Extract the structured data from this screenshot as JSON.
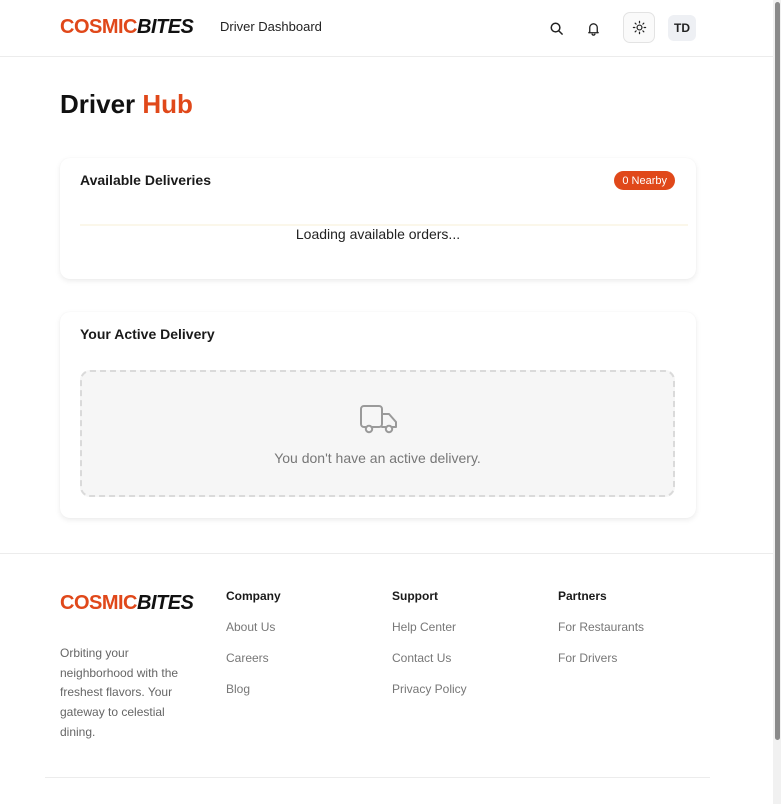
{
  "header": {
    "logo_part1": "COSMIC",
    "logo_part2": "BITES",
    "nav_title": "Driver Dashboard",
    "avatar_initials": "TD",
    "icons": [
      "search-icon",
      "bell-icon",
      "sun-icon"
    ]
  },
  "main": {
    "title_part1": "Driver ",
    "title_part2": "Hub",
    "available": {
      "title": "Available Deliveries",
      "badge": "0 Nearby",
      "loading": "Loading available orders..."
    },
    "active": {
      "title": "Your Active Delivery",
      "empty_text": "You don't have an active delivery.",
      "icon": "truck-icon"
    }
  },
  "footer": {
    "logo_part1": "COSMIC",
    "logo_part2": "BITES",
    "tagline": "Orbiting your neighborhood with the freshest flavors. Your gateway to celestial dining.",
    "columns": [
      {
        "title": "Company",
        "links": [
          "About Us",
          "Careers",
          "Blog"
        ]
      },
      {
        "title": "Support",
        "links": [
          "Help Center",
          "Contact Us",
          "Privacy Policy"
        ]
      },
      {
        "title": "Partners",
        "links": [
          "For Restaurants",
          "For Drivers"
        ]
      }
    ]
  },
  "colors": {
    "accent": "#e0481a",
    "text": "#1a1a1a",
    "muted": "#777777"
  }
}
